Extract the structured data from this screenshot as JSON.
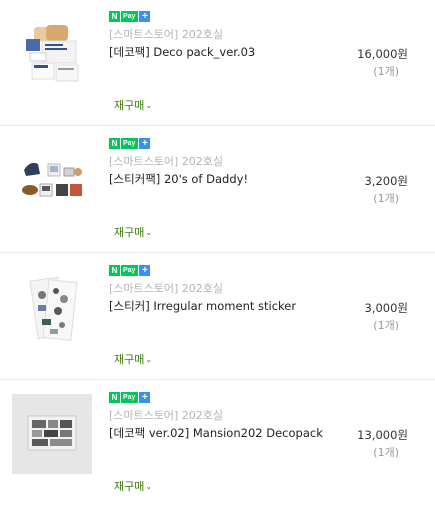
{
  "badge": {
    "n": "N",
    "pay": "Pay",
    "plus": "+"
  },
  "rebuy_label": "재구매",
  "items": [
    {
      "store": "[스마트스토어] 202호실",
      "title": "[데코팩] Deco pack_ver.03",
      "price": "16,000원",
      "qty": "(1개)"
    },
    {
      "store": "[스마트스토어] 202호실",
      "title": "[스티커팩] 20's of Daddy!",
      "price": "3,200원",
      "qty": "(1개)"
    },
    {
      "store": "[스마트스토어] 202호실",
      "title": "[스티커] Irregular moment sticker",
      "price": "3,000원",
      "qty": "(1개)"
    },
    {
      "store": "[스마트스토어] 202호실",
      "title": "[데코팩 ver.02] Mansion202 Decopack",
      "price": "13,000원",
      "qty": "(1개)"
    }
  ],
  "colors": {
    "npay_green": "#03c75a",
    "plus_blue": "#3a8ff3",
    "rebuy_green": "#3b7d0a"
  }
}
